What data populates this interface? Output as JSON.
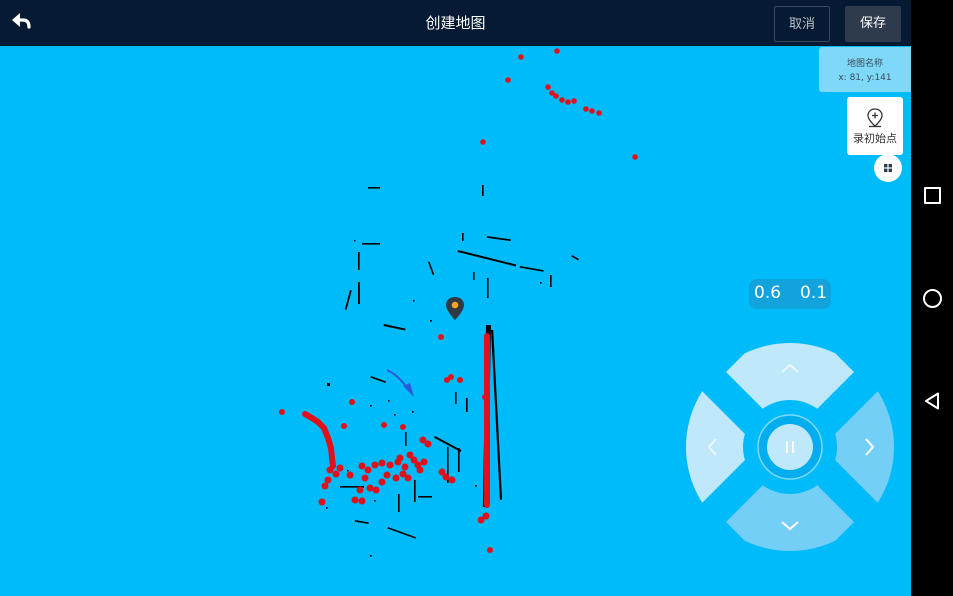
{
  "header": {
    "title": "创建地图",
    "cancel_label": "取消",
    "save_label": "保存",
    "back_icon": "back-arrow-icon"
  },
  "map_info": {
    "name_label": "地图名称",
    "coords": "x: 81, y:141"
  },
  "record_button": {
    "label": "录初始点",
    "icon": "location-pin-plus-icon"
  },
  "grid_button": {
    "icon": "grid-icon"
  },
  "speed": {
    "linear": "0.6",
    "angular": "0.1"
  },
  "joystick": {
    "up_icon": "chevron-up-icon",
    "down_icon": "chevron-down-icon",
    "left_icon": "chevron-left-icon",
    "right_icon": "chevron-right-icon",
    "center_icon": "pause-icon"
  },
  "system_nav": [
    "recent-apps-icon",
    "home-icon",
    "back-icon"
  ],
  "colors": {
    "map_background": "#00bbf9",
    "topbar": "#071a33",
    "laser_points": "#e0111b",
    "obstacles": "#000000",
    "robot_marker": "#2f3a45",
    "robot_marker_dot": "#f5a623",
    "heading_arrow": "#2d5bd8"
  }
}
